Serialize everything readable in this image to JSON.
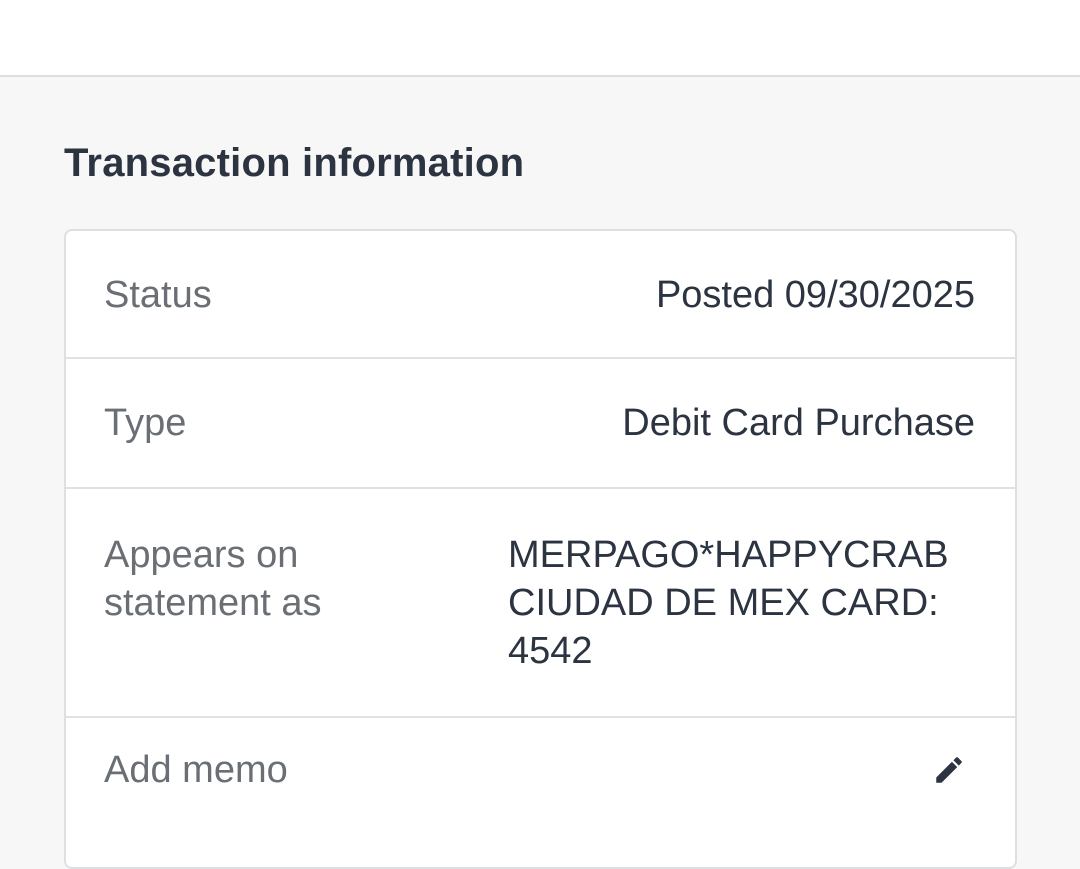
{
  "section": {
    "title": "Transaction information"
  },
  "rows": {
    "status": {
      "label": "Status",
      "value": "Posted 09/30/2025"
    },
    "type": {
      "label": "Type",
      "value": "Debit Card Purchase"
    },
    "statement": {
      "label": "Appears on statement as",
      "value": "MERPAGO*HAPPYCRAB CIUDAD DE MEX CARD: 4542"
    },
    "memo": {
      "label": "Add memo",
      "icon": "pencil-icon"
    }
  },
  "colors": {
    "text": "#2b3440",
    "label": "#6a6f75",
    "background": "#f7f7f7",
    "card": "#ffffff",
    "border": "#dedfe1"
  }
}
